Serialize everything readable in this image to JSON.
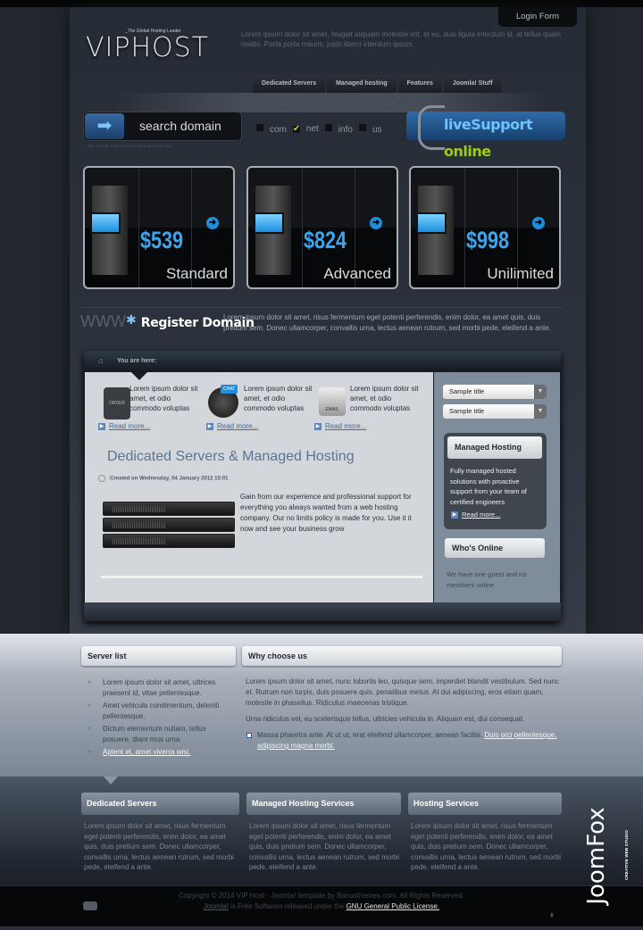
{
  "header": {
    "login_label": "Login Form",
    "logo_text": "VIPHOST",
    "tagline": "_The Global Hosting Leader",
    "intro": "Lorem ipsum dolor sit amet, feugiat aliquam molestie elit, et eu, duis ligula interdum id, at tellus quam mattis. Porta porta mauris, justo libero interdum ipsum."
  },
  "nav": [
    "Dedicated Servers",
    "Managed hosting",
    "Features",
    "Joomla! Stuff"
  ],
  "search": {
    "label": "search domain",
    "note": "* This module is for demonstration purposes only.",
    "tlds": [
      {
        "label": "com",
        "checked": false
      },
      {
        "label": "net",
        "checked": true
      },
      {
        "label": "info",
        "checked": false
      },
      {
        "label": "us",
        "checked": false
      }
    ]
  },
  "live_support": {
    "part1": "liveSupport",
    "part2": "online"
  },
  "plans": [
    {
      "price": "$539",
      "name": "Standard"
    },
    {
      "price": "$824",
      "name": "Advanced"
    },
    {
      "price": "$998",
      "name": "Unilimited"
    }
  ],
  "register": {
    "www": "WWW",
    "title": "Register Domain",
    "text": "Lorem ipsum dolor sit amet, risus fermentum eget potenti perferendis, enim dolor, ea amet quis, duis pretium sem. Donec ullamcorper, convallis urna, lectus aenean rutrum, sed morbi pede, eleifend a ante."
  },
  "breadcrumb": {
    "label": "You are here:"
  },
  "features": [
    {
      "icon": "order-bag-icon",
      "icon_text": "ORDER",
      "text": "Lorem ipsum dolor sit amet, et odio commodo voluptas",
      "link": "Read more..."
    },
    {
      "icon": "chat-globe-icon",
      "icon_text": "CHAT",
      "text": "Lorem ipsum dolor sit amet, et odio commodo voluptas",
      "link": "Read more..."
    },
    {
      "icon": "email-envelope-icon",
      "icon_text": "EMAIL",
      "text": "Lorem ipsum dolor sit amet, et odio commodo voluptas",
      "link": "Read more..."
    }
  ],
  "article": {
    "title": "Dedicated Servers & Managed Hosting",
    "created": "Created on Wednesday, 04 January 2012 15:01",
    "body": "Gain from our experience and professional support for everything you always wanted from a web hosting company. Our no limits policy is made for you. Use it it now and see your business grow"
  },
  "sidebar": {
    "selects": [
      "Sample title",
      "Sample title"
    ],
    "managed": {
      "title": "Managed Hosting",
      "text": "Fully managed hosted solutions with proactive support from your team of certified engineers",
      "link": "Read more..."
    },
    "online": {
      "title": "Who's Online",
      "text": "We have one guest and no members online"
    }
  },
  "server_list": {
    "title": "Server list",
    "items": [
      "Lorem ipsum dolor sit amet, ultrices praesent id, vitae pellentesque.",
      "Amet vehicula condimentum, deleniti pellentesque.",
      "Dictum elementum nullam, tellus posuere, diam mus urna."
    ],
    "link": "Aptent et, amet viverra wisi."
  },
  "why": {
    "title": "Why choose us",
    "p1": "Lorem ipsum dolor sit amet, nunc lobortis leo, quisque sem, imperdiet blandit vestibulum. Sed nunc et. Rutrum non turpis, duis posuere quis, penatibus metus. At dui adipiscing, eros etiam quam, molestie in phasellus. Ridiculus maecenas tristique.",
    "p2": "Urna ridiculus vel, eu scelerisque tellus, ultricies vehicula in. Aliquam est, dui consequat.",
    "bullet": "Massa pharetra ante. At ut ut, erat eleifend ullamcorper, aenean facilisi.",
    "bullet_link": "Duis orci pellentesque, adipiscing magna morbi."
  },
  "footer_modules": [
    {
      "title": "Dedicated Servers",
      "text": "Lorem ipsum dolor sit amet, risus fermentum eget potenti perferendis, enim dolor, ea amet quis, duis pretium sem. Donec ullamcorper, convallis urna, lectus aenean rutrum, sed morbi pede, eleifend a ante."
    },
    {
      "title": "Managed Hosting Services",
      "text": "Lorem ipsum dolor sit amet, risus fermentum eget potenti perferendis, enim dolor, ea amet quis, duis pretium sem. Donec ullamcorper, convallis urna, lectus aenean rutrum, sed morbi pede, eleifend a ante."
    },
    {
      "title": "Hosting Services",
      "text": "Lorem ipsum dolor sit amet, risus fermentum eget potenti perferendis, enim dolor, ea amet quis, duis pretium sem. Donec ullamcorper, convallis urna, lectus aenean rutrum, sed morbi pede, eleifend a ante."
    }
  ],
  "copyright": {
    "line1": "Copyright © 2014 VIP Host - Joomla! template by Bonusthemes.com. All Rights Reserved.",
    "joomla_link": "Joomla!",
    "middle": " is Free Software released under the ",
    "license_link": "GNU General Public License."
  },
  "brand": {
    "logo_text": "JoomFox",
    "sub": "CREATIVE WEB STUDIO"
  },
  "colors": {
    "accent_blue": "#3aa6ef",
    "live_green": "#9ccd1e",
    "link_blue": "#41699a"
  }
}
